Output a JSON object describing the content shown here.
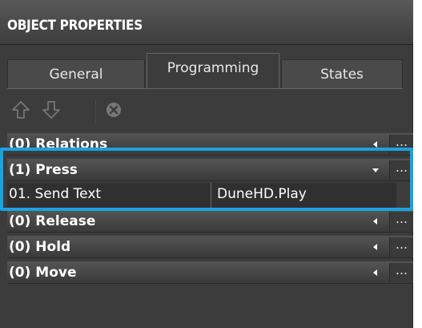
{
  "panel": {
    "title": "OBJECT PROPERTIES"
  },
  "tabs": [
    {
      "label": "General",
      "active": false
    },
    {
      "label": "Programming",
      "active": true
    },
    {
      "label": "States",
      "active": false
    }
  ],
  "toolbar": {
    "buttons": [
      {
        "icon": "arrow-up-icon",
        "enabled": false
      },
      {
        "icon": "arrow-down-icon",
        "enabled": false
      },
      {
        "icon": "delete-icon",
        "enabled": false
      }
    ]
  },
  "groups": [
    {
      "label": "(0) Relations",
      "expanded": false,
      "more": "..."
    },
    {
      "label": "(1) Press",
      "expanded": true,
      "more": "...",
      "actions": [
        {
          "name": "01. Send Text",
          "value": "DuneHD.Play"
        }
      ]
    },
    {
      "label": "(0) Release",
      "expanded": false,
      "more": "..."
    },
    {
      "label": "(0) Hold",
      "expanded": false,
      "more": "..."
    },
    {
      "label": "(0) Move",
      "expanded": false,
      "more": "..."
    }
  ],
  "colors": {
    "panel_bg": "#3c3c3c",
    "header_bg": "#4a4a4a",
    "selection": "#1aa3e0",
    "text": "#ffffff"
  }
}
